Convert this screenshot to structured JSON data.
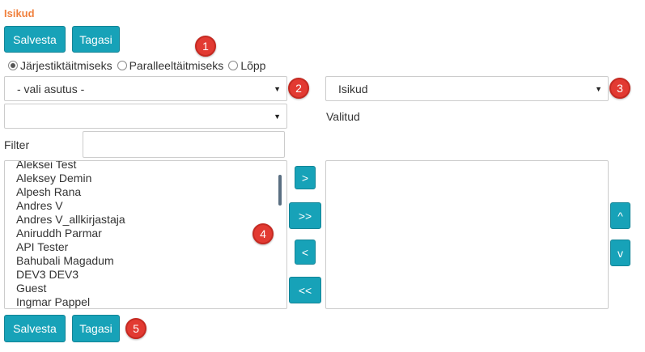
{
  "page": {
    "title": "Isikud"
  },
  "top_buttons": {
    "save": "Salvesta",
    "back": "Tagasi"
  },
  "bottom_buttons": {
    "save": "Salvesta",
    "back": "Tagasi"
  },
  "modes": {
    "options": [
      "Järjestiktäitmiseks",
      "Paralleeltäitmiseks",
      "Lõpp"
    ],
    "selected": "Järjestiktäitmiseks"
  },
  "selects": {
    "institution": "- vali asutus -",
    "secondary": "",
    "type": "Isikud"
  },
  "labels": {
    "valitud": "Valitud",
    "filter": "Filter"
  },
  "filter": {
    "value": ""
  },
  "available_list": {
    "items": [
      "Aleksei Test",
      "Aleksey Demin",
      "Alpesh Rana",
      "Andres V",
      "Andres V_allkirjastaja",
      "Aniruddh Parmar",
      "API Tester",
      "Bahubali Magadum",
      "DEV3 DEV3",
      "Guest",
      "Ingmar Pappel"
    ]
  },
  "selected_list": {
    "items": []
  },
  "transfer_buttons": {
    "add": ">",
    "add_all": ">>",
    "remove": "<",
    "remove_all": "<<"
  },
  "order_buttons": {
    "up": "^",
    "down": "v"
  },
  "markers": {
    "m1": "1",
    "m2": "2",
    "m3": "3",
    "m4": "4",
    "m5": "5"
  },
  "colors": {
    "accent": "#17a2b8",
    "title": "#f0813e",
    "marker": "#e23a32"
  },
  "icons": {
    "caret": "caret-down-icon"
  }
}
